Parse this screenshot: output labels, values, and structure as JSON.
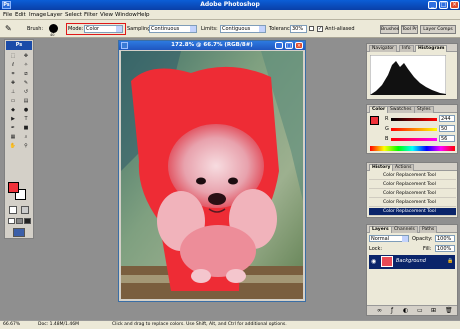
{
  "app": {
    "title": "Adobe Photoshop"
  },
  "menu": [
    "File",
    "Edit",
    "Image",
    "Layer",
    "Select",
    "Filter",
    "View",
    "Window",
    "Help"
  ],
  "options": {
    "brush_label": "Brush:",
    "brush_size": "40",
    "mode_label": "Mode:",
    "mode_value": "Color",
    "sampling_label": "Sampling:",
    "sampling_value": "Continuous",
    "limits_label": "Limits:",
    "limits_value": "Contiguous",
    "tolerance_label": "Tolerance:",
    "tolerance_value": "30%",
    "antialiased_label": "Anti-aliased",
    "tabs": [
      "Brushes",
      "Tool Pr",
      "Layer Comps"
    ]
  },
  "document": {
    "title": "172.8% @ 66.7% (RGB/8#)"
  },
  "navigator": {
    "tabs": [
      "Navigator",
      "Info",
      "Histogram"
    ]
  },
  "color_panel": {
    "tabs": [
      "Color",
      "Swatches",
      "Styles"
    ],
    "channels": [
      {
        "label": "R",
        "value": "244",
        "color": "#ff0000"
      },
      {
        "label": "G",
        "value": "50",
        "color": "#00ff00"
      },
      {
        "label": "B",
        "value": "56",
        "color": "#0000ff"
      }
    ],
    "fg": "#f0323a"
  },
  "history": {
    "tabs": [
      "History",
      "Actions"
    ],
    "items": [
      "Color Replacement Tool",
      "Color Replacement Tool",
      "Color Replacement Tool",
      "Color Replacement Tool",
      "Color Replacement Tool"
    ]
  },
  "layers": {
    "tabs": [
      "Layers",
      "Channels",
      "Paths"
    ],
    "blend": "Normal",
    "opacity_label": "Opacity:",
    "opacity": "100%",
    "fill_label": "Fill:",
    "fill": "100%",
    "lock_label": "Lock:",
    "layer_name": "Background"
  },
  "status": {
    "zoom": "66.67%",
    "doc": "Doc: 1.48M/1.46M",
    "hint": "Click and drag to replace colors. Use Shift, Alt, and Ctrl for additional options."
  }
}
